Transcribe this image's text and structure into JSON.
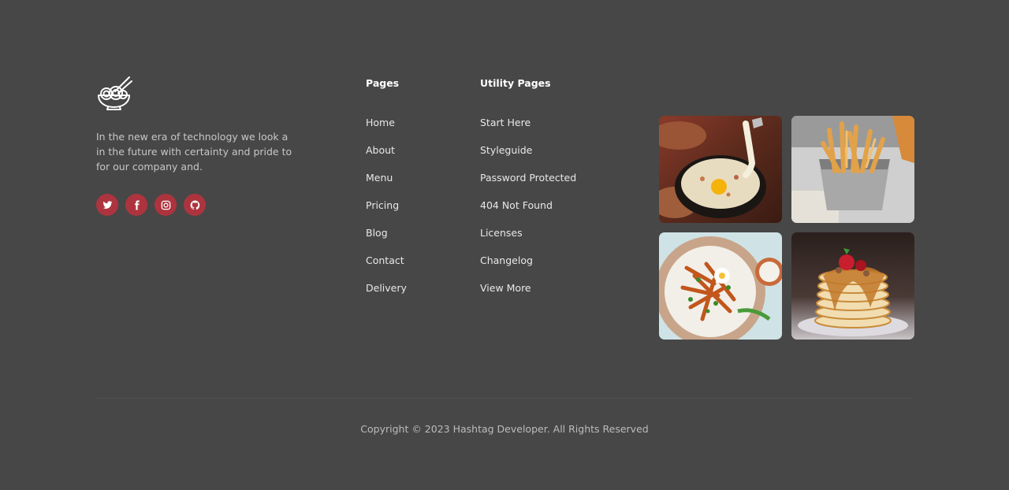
{
  "brand": {
    "logo_icon": "noodle-bowl-chopsticks-icon",
    "description": "In the new era of technology we look a in the future with certainty and pride to for our company and."
  },
  "socials": [
    {
      "name": "twitter",
      "icon": "twitter-icon"
    },
    {
      "name": "facebook",
      "icon": "facebook-icon"
    },
    {
      "name": "instagram",
      "icon": "instagram-icon"
    },
    {
      "name": "github",
      "icon": "github-icon"
    }
  ],
  "pages": {
    "title": "Pages",
    "items": [
      "Home",
      "About",
      "Menu",
      "Pricing",
      "Blog",
      "Contact",
      "Delivery"
    ]
  },
  "utility": {
    "title": "Utility Pages",
    "items": [
      "Start Here",
      "Styleguide",
      "Password Protected",
      "404 Not Found",
      "Licenses",
      "Changelog",
      "View More"
    ]
  },
  "gallery": [
    {
      "subject": "cheese-egg-bowl-photo"
    },
    {
      "subject": "french-fries-photo"
    },
    {
      "subject": "sweet-potato-fries-plate-photo"
    },
    {
      "subject": "pancake-stack-photo"
    }
  ],
  "footer": {
    "copyright": "Copyright © 2023 Hashtag Developer. All Rights Reserved"
  },
  "colors": {
    "background": "#474747",
    "accent": "#ad343e",
    "heading": "#ffffff",
    "text": "#e8e8e8",
    "muted": "#c7c7c7"
  }
}
